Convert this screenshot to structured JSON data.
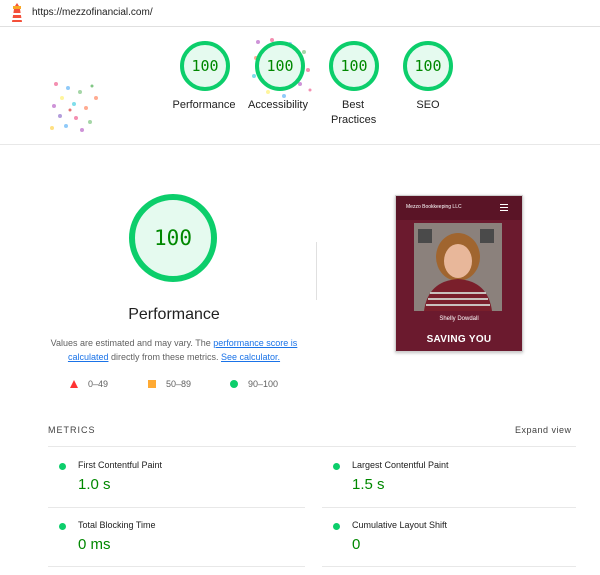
{
  "browser": {
    "url": "https://mezzofinancial.com/"
  },
  "categories": [
    {
      "label": "Performance",
      "score": "100"
    },
    {
      "label": "Accessibility",
      "score": "100"
    },
    {
      "label": "Best Practices",
      "score": "100"
    },
    {
      "label": "SEO",
      "score": "100"
    }
  ],
  "performance": {
    "score": "100",
    "title": "Performance",
    "desc_prefix": "Values are estimated and may vary. The ",
    "link_score": "performance score is calculated",
    "desc_middle": " directly from these metrics. ",
    "link_calc": "See calculator."
  },
  "legend": [
    {
      "range": "0–49",
      "color": "#ff3333",
      "shape": "triangle"
    },
    {
      "range": "50–89",
      "color": "#ffaa33",
      "shape": "square"
    },
    {
      "range": "90–100",
      "color": "#0cce6b",
      "shape": "circle"
    }
  ],
  "screenshot": {
    "brand": "Mezzo Bookkeeping LLC",
    "name": "Shelly Dowdall",
    "cta": "SAVING YOU"
  },
  "metrics": {
    "title": "METRICS",
    "expand_label": "Expand view",
    "items": [
      {
        "name": "First Contentful Paint",
        "value": "1.0 s"
      },
      {
        "name": "Largest Contentful Paint",
        "value": "1.5 s"
      },
      {
        "name": "Total Blocking Time",
        "value": "0 ms"
      },
      {
        "name": "Cumulative Layout Shift",
        "value": "0"
      }
    ]
  },
  "colors": {
    "pass": "#0cce6b",
    "pass_text": "#008800",
    "pass_fill": "#e5faef",
    "link": "#1a73e8"
  }
}
